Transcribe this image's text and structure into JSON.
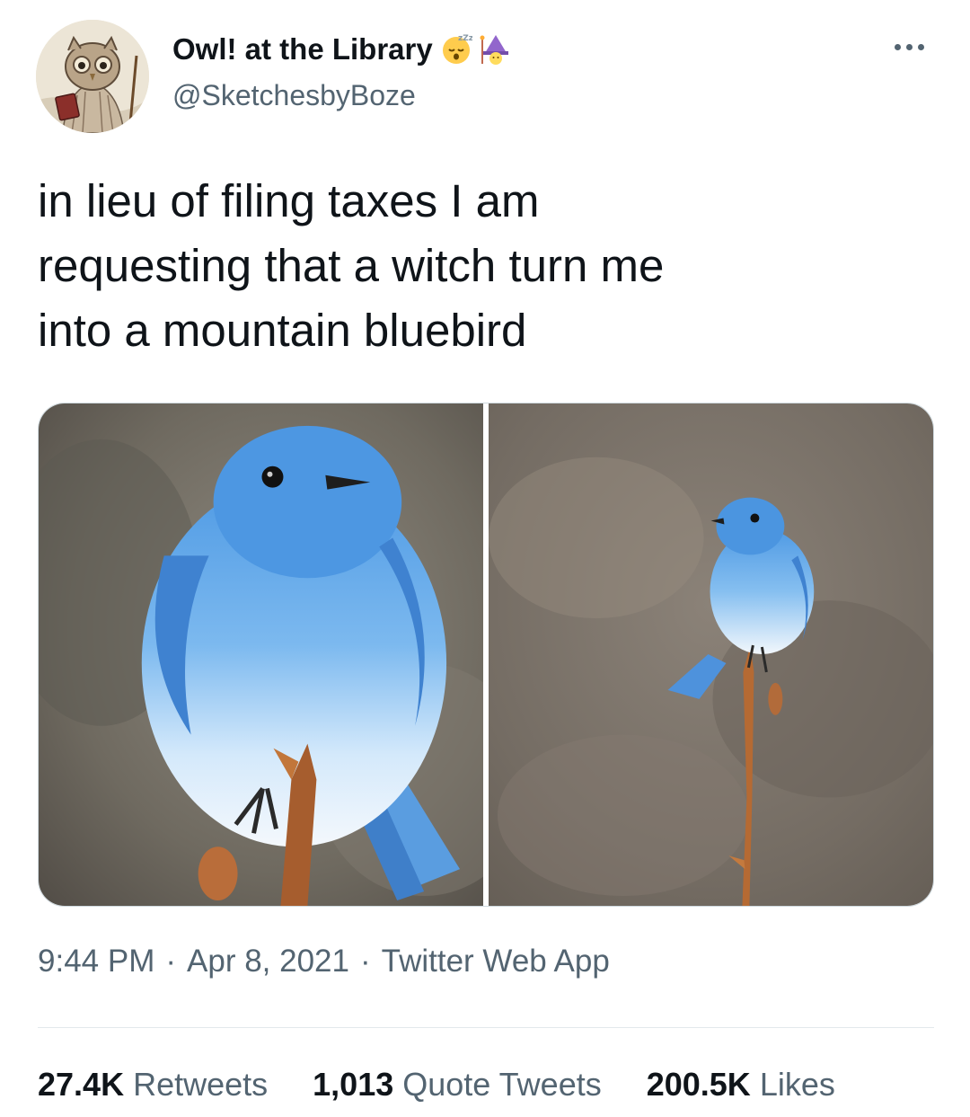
{
  "author": {
    "display_name": "Owl! at the Library",
    "handle": "@SketchesbyBoze",
    "name_emoji": [
      "sleeping-face-emoji",
      "woman-mage-emoji"
    ]
  },
  "tweet": {
    "text_lines": [
      "in lieu of filing taxes I am",
      "requesting that a witch turn me",
      "into a mountain bluebird"
    ]
  },
  "media": [
    {
      "icon": "bluebird-closeup-photo"
    },
    {
      "icon": "bluebird-on-stem-photo"
    }
  ],
  "meta": {
    "time": "9:44 PM",
    "separator": "·",
    "date": "Apr 8, 2021",
    "source": "Twitter Web App"
  },
  "stats": {
    "retweets_count": "27.4K",
    "retweets_label": "Retweets",
    "quotes_count": "1,013",
    "quotes_label": "Quote Tweets",
    "likes_count": "200.5K",
    "likes_label": "Likes"
  },
  "colors": {
    "text_primary": "#0f1419",
    "text_secondary": "#536471",
    "divider": "#e3e8ec",
    "bird_blue": "#5aa9e6"
  }
}
